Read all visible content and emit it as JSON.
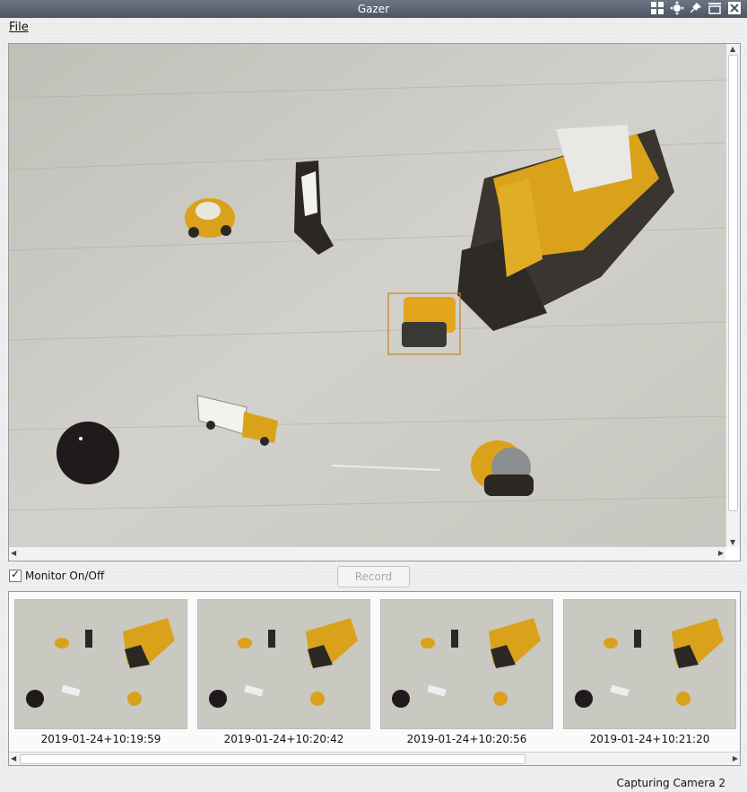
{
  "window": {
    "title": "Gazer"
  },
  "menu": {
    "file_label": "File"
  },
  "controls": {
    "monitor_label": "Monitor On/Off",
    "monitor_checked": true,
    "record_label": "Record",
    "record_enabled": false
  },
  "thumbnails": [
    {
      "timestamp": "2019-01-24+10:19:59"
    },
    {
      "timestamp": "2019-01-24+10:20:42"
    },
    {
      "timestamp": "2019-01-24+10:20:56"
    },
    {
      "timestamp": "2019-01-24+10:21:20"
    }
  ],
  "status": {
    "text": "Capturing Camera 2"
  },
  "colors": {
    "titlebar": "#5b6371",
    "floor": "#c9c8c1",
    "toy_yellow": "#d9a21a",
    "detection_box": "#c8841a"
  },
  "icons": [
    "grid-icon",
    "move-icon",
    "pin-icon",
    "minimize-icon",
    "close-icon"
  ]
}
